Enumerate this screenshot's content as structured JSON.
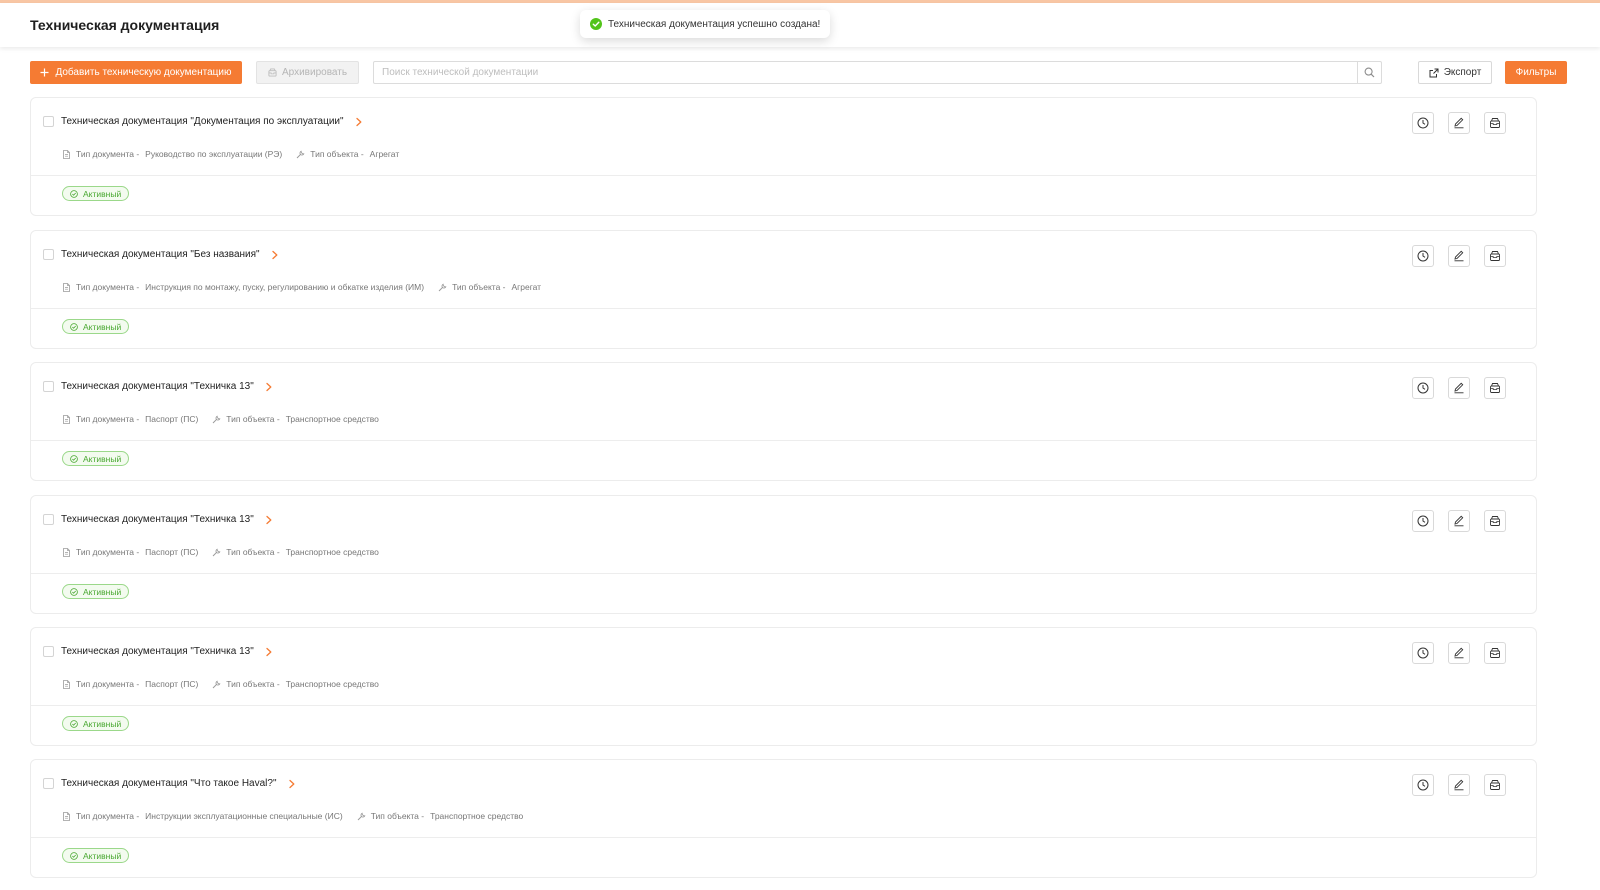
{
  "header": {
    "title": "Техническая документация"
  },
  "toast": {
    "message": "Техническая документация успешно создана!",
    "icon": "check-circle-icon"
  },
  "toolbar": {
    "add_label": "Добавить техническую документацию",
    "archive_label": "Архивировать",
    "search_placeholder": "Поиск технической документации",
    "export_label": "Экспорт",
    "filters_label": "Фильтры"
  },
  "labels": {
    "doc_type": "Тип документа -",
    "object_type": "Тип объекта -"
  },
  "items": [
    {
      "title": "Техническая документация \"Документация по эксплуатации\"",
      "doc_type": "Руководство по эксплуатации (РЭ)",
      "object_type": "Агрегат",
      "status": "Активный"
    },
    {
      "title": "Техническая документация \"Без названия\"",
      "doc_type": "Инструкция по монтажу, пуску, регулированию и обкатке изделия (ИМ)",
      "object_type": "Агрегат",
      "status": "Активный"
    },
    {
      "title": "Техническая документация \"Техничка 13\"",
      "doc_type": "Паспорт (ПС)",
      "object_type": "Транспортное средство",
      "status": "Активный"
    },
    {
      "title": "Техническая документация \"Техничка 13\"",
      "doc_type": "Паспорт (ПС)",
      "object_type": "Транспортное средство",
      "status": "Активный"
    },
    {
      "title": "Техническая документация \"Техничка 13\"",
      "doc_type": "Паспорт (ПС)",
      "object_type": "Транспортное средство",
      "status": "Активный"
    },
    {
      "title": "Техническая документация \"Что такое Haval?\"",
      "doc_type": "Инструкции эксплуатационные специальные (ИС)",
      "object_type": "Транспортное средство",
      "status": "Активный"
    }
  ],
  "colors": {
    "accent": "#f57b33",
    "success": "#4aa832",
    "status_border": "#9bd88a"
  }
}
